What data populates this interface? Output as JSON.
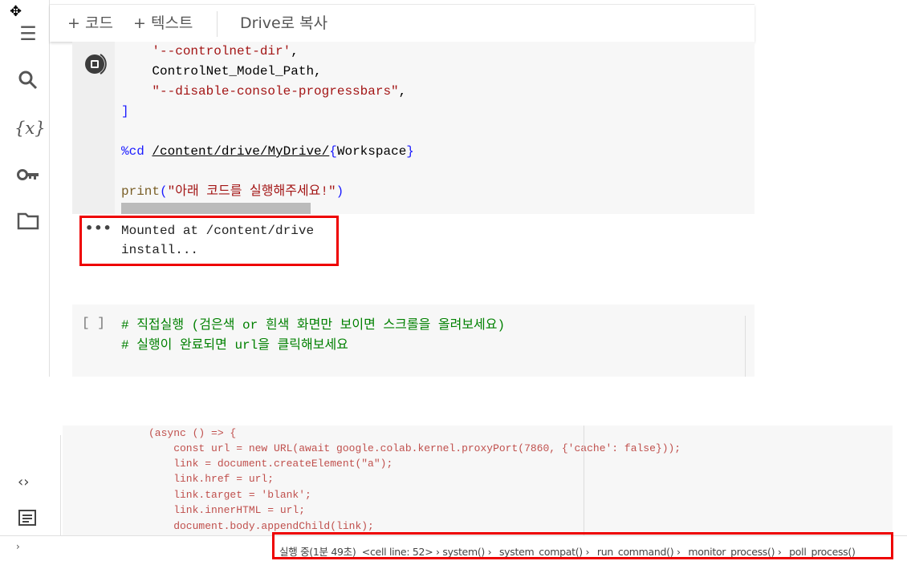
{
  "sidebar": {
    "icons": [
      "toc-icon",
      "search-icon",
      "variables-icon",
      "key-icon",
      "folder-icon"
    ],
    "variables_glyph": "{x}"
  },
  "toolbar": {
    "add_code": "+ 코드",
    "add_text": "+ 텍스트",
    "copy_to_drive": "Drive로 복사"
  },
  "cell1": {
    "code_lines": [
      {
        "indent": "    ",
        "text": "'--controlnet-dir'",
        "suffix": ","
      },
      {
        "indent": "    ",
        "text": "ControlNet_Model_Path,"
      },
      {
        "indent": "    ",
        "text": "\"--disable-console-progressbars\"",
        "suffix": ","
      },
      {
        "text": "]"
      },
      {
        "magic": "%cd",
        "path": "/content/drive/MyDrive/",
        "brace_open": "{",
        "var": "Workspace",
        "brace_close": "}"
      },
      {
        "fn": "print",
        "paren_open": "(",
        "str": "\"아래 코드를 실행해주세요!\"",
        "paren_close": ")"
      }
    ],
    "output_lines": [
      "Mounted at /content/drive",
      "install..."
    ],
    "running": true
  },
  "cell2": {
    "run_label": "[ ]",
    "lines": [
      "# 직접실행 (검은색 or 흰색 화면만 보이면 스크롤을 올려보세요)",
      "# 실행이 완료되면 url을 클릭해보세요"
    ]
  },
  "bottom_code": {
    "lines": [
      "(async () => {",
      "    const url = new URL(await google.colab.kernel.proxyPort(7860, {'cache': false}));",
      "    link = document.createElement(\"a\");",
      "    link.href = url;",
      "    link.target = 'blank';",
      "    link.innerHTML = url;",
      "    document.body.appendChild(link);"
    ]
  },
  "status": {
    "text": "실행 중(1분 49초)  <cell line: 52> › system() › _system_compat() › _run_command() › _monitor_process() › _poll_process()"
  },
  "colors": {
    "highlight": "#ee0000",
    "string": "#a31515",
    "comment": "#008000",
    "keyword": "#1a1aff"
  }
}
